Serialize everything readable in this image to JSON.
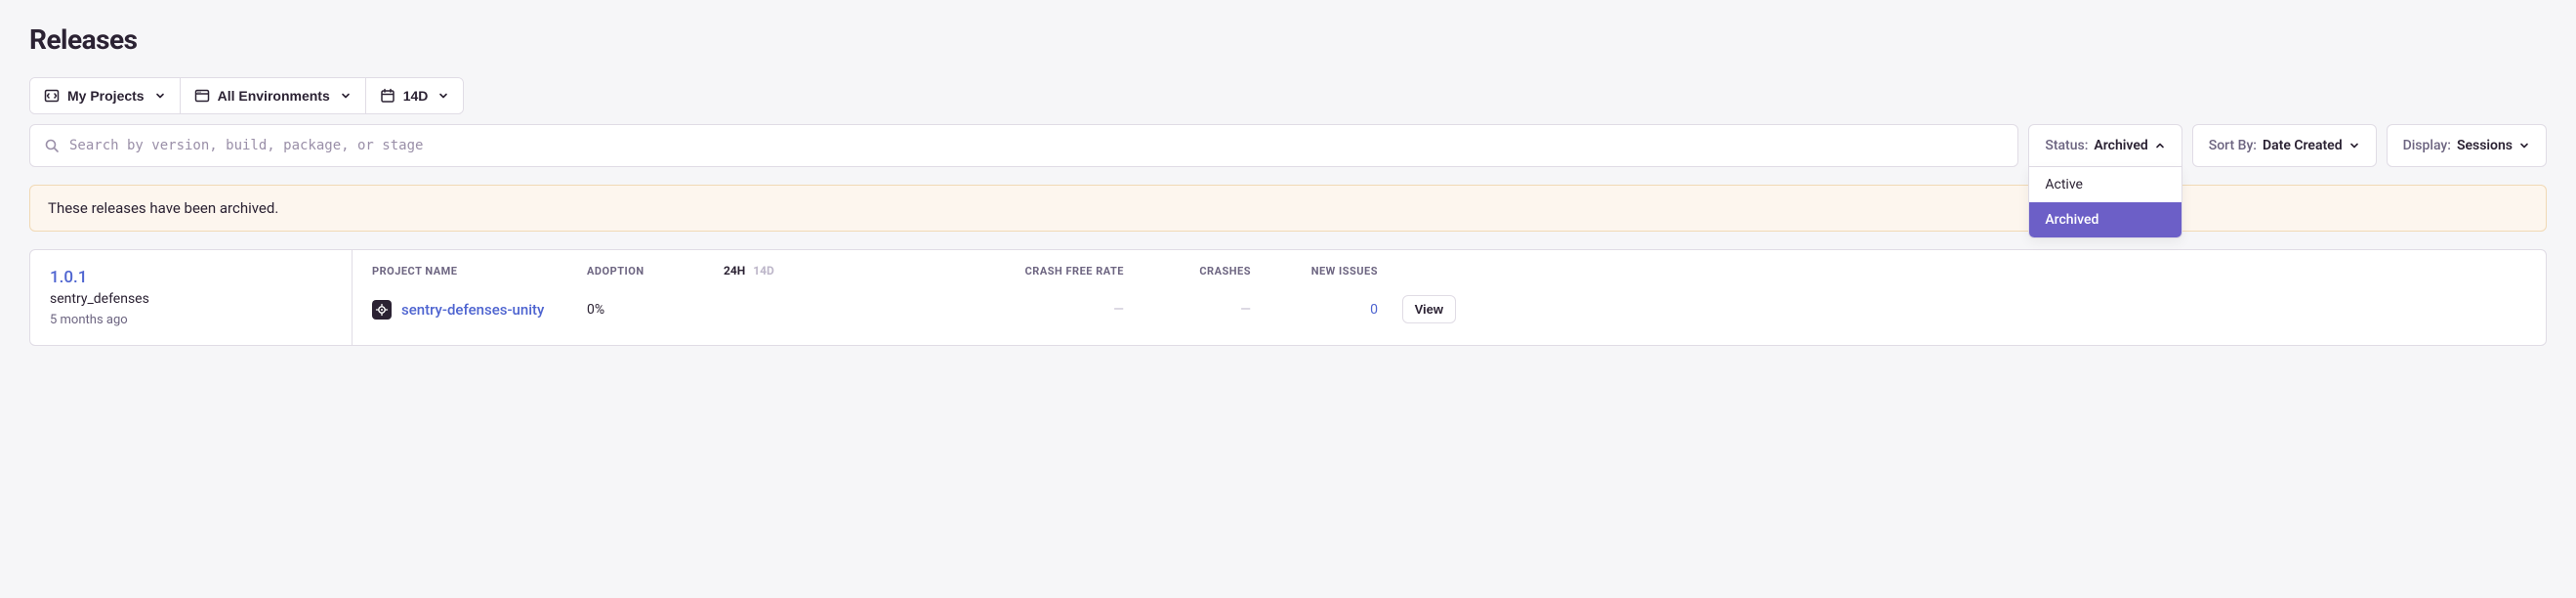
{
  "page": {
    "title": "Releases"
  },
  "filters": {
    "projects_label": "My Projects",
    "environments_label": "All Environments",
    "period_label": "14D"
  },
  "search": {
    "placeholder": "Search by version, build, package, or stage"
  },
  "status": {
    "label": "Status:",
    "value": "Archived",
    "options": [
      "Active",
      "Archived"
    ],
    "selected": "Archived"
  },
  "sort": {
    "label": "Sort By:",
    "value": "Date Created"
  },
  "display": {
    "label": "Display:",
    "value": "Sessions"
  },
  "banner": {
    "message": "These releases have been archived."
  },
  "release": {
    "version": "1.0.1",
    "project_tag": "sentry_defenses",
    "age": "5 months ago"
  },
  "table": {
    "headers": {
      "project_name": "PROJECT NAME",
      "adoption": "ADOPTION",
      "crash_free": "CRASH FREE RATE",
      "crashes": "CRASHES",
      "new_issues": "NEW ISSUES"
    },
    "period": {
      "active": "24H",
      "inactive": "14D"
    },
    "row": {
      "project_name": "sentry-defenses-unity",
      "adoption": "0%",
      "crash_free": "—",
      "crashes": "—",
      "new_issues": "0",
      "view_label": "View"
    }
  }
}
